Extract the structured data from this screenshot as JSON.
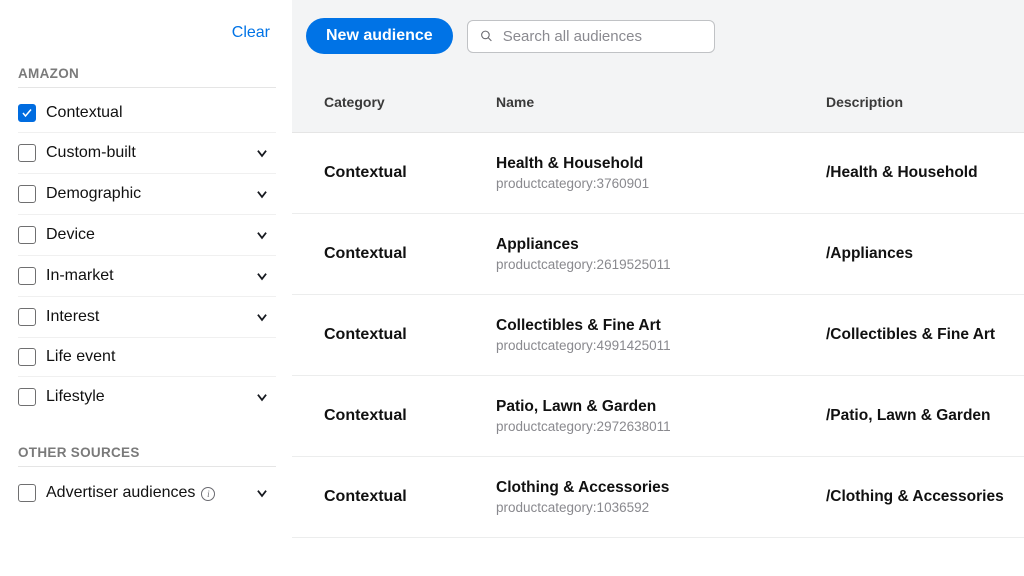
{
  "sidebar": {
    "clear_label": "Clear",
    "section_amazon": "AMAZON",
    "section_other": "OTHER SOURCES",
    "amazon_filters": [
      {
        "label": "Contextual",
        "checked": true,
        "expandable": false
      },
      {
        "label": "Custom-built",
        "checked": false,
        "expandable": true
      },
      {
        "label": "Demographic",
        "checked": false,
        "expandable": true
      },
      {
        "label": "Device",
        "checked": false,
        "expandable": true
      },
      {
        "label": "In-market",
        "checked": false,
        "expandable": true
      },
      {
        "label": "Interest",
        "checked": false,
        "expandable": true
      },
      {
        "label": "Life event",
        "checked": false,
        "expandable": false
      },
      {
        "label": "Lifestyle",
        "checked": false,
        "expandable": true
      }
    ],
    "other_filters": [
      {
        "label": "Advertiser audiences",
        "checked": false,
        "expandable": true,
        "info": true
      }
    ]
  },
  "toolbar": {
    "new_audience_label": "New audience",
    "search_placeholder": "Search all audiences"
  },
  "table": {
    "headers": {
      "category": "Category",
      "name": "Name",
      "description": "Description"
    },
    "rows": [
      {
        "category": "Contextual",
        "name": "Health & Household",
        "sub": "productcategory:3760901",
        "description": "/Health & Household"
      },
      {
        "category": "Contextual",
        "name": "Appliances",
        "sub": "productcategory:2619525011",
        "description": "/Appliances"
      },
      {
        "category": "Contextual",
        "name": "Collectibles & Fine Art",
        "sub": "productcategory:4991425011",
        "description": "/Collectibles & Fine Art"
      },
      {
        "category": "Contextual",
        "name": "Patio, Lawn & Garden",
        "sub": "productcategory:2972638011",
        "description": "/Patio, Lawn & Garden"
      },
      {
        "category": "Contextual",
        "name": "Clothing & Accessories",
        "sub": "productcategory:1036592",
        "description": "/Clothing & Accessories"
      }
    ]
  }
}
